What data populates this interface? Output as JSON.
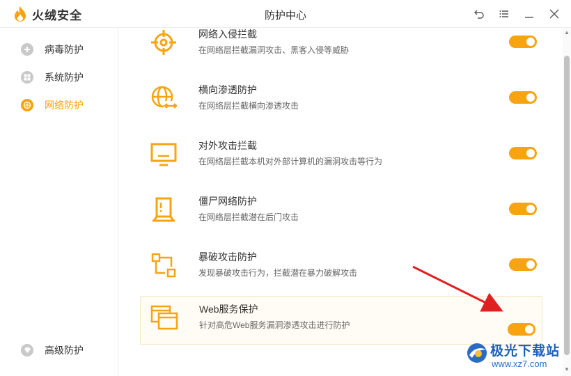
{
  "app": {
    "name": "火绒安全",
    "window_title": "防护中心"
  },
  "window_buttons": [
    {
      "name": "back-icon",
      "glyph": "↶"
    },
    {
      "name": "menu-icon",
      "glyph": "☰"
    },
    {
      "name": "minimize-icon",
      "glyph": "—"
    },
    {
      "name": "close-icon",
      "glyph": "✕"
    }
  ],
  "sidebar": {
    "items": [
      {
        "label": "病毒防护",
        "active": false
      },
      {
        "label": "系统防护",
        "active": false
      },
      {
        "label": "网络防护",
        "active": true
      }
    ],
    "bottom_item": {
      "label": "高级防护"
    }
  },
  "protections": [
    {
      "title": "网络入侵拦截",
      "desc": "在网络层拦截漏洞攻击、黑客入侵等威胁",
      "enabled": true
    },
    {
      "title": "横向渗透防护",
      "desc": "在网络层拦截横向渗透攻击",
      "enabled": true
    },
    {
      "title": "对外攻击拦截",
      "desc": "在网络层拦截本机对外部计算机的漏洞攻击等行为",
      "enabled": true
    },
    {
      "title": "僵尸网络防护",
      "desc": "在网络层拦截潜在后门攻击",
      "enabled": true
    },
    {
      "title": "暴破攻击防护",
      "desc": "发现暴破攻击行为，拦截潜在暴力破解攻击",
      "enabled": true
    },
    {
      "title": "Web服务保护",
      "desc": "针对高危Web服务漏洞渗透攻击进行防护",
      "enabled": true
    }
  ],
  "watermark": {
    "name": "极光下载站",
    "url": "www.xz7.com"
  },
  "colors": {
    "accent": "#f7a410",
    "annotation_arrow": "#e02020"
  }
}
